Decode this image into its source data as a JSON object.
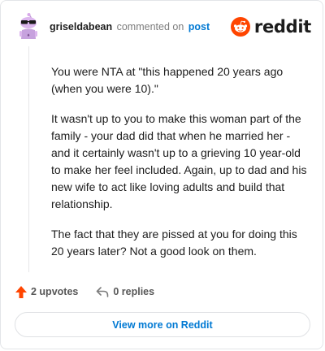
{
  "header": {
    "username": "griseldabean",
    "action_text": "commented on",
    "post_link": "post",
    "brand": "reddit"
  },
  "comment": {
    "paragraphs": [
      "You were NTA at \"this happened 20 years ago (when you were 10).\"",
      "It wasn't up to you to make this woman part of the family - your dad did that when he married her - and it certainly wasn't up to a grieving 10 year-old to make her feel included. Again, up to dad and his new wife to act like loving adults and build that relationship.",
      "The fact that they are pissed at you for doing this 20 years later? Not a good look on them."
    ]
  },
  "actions": {
    "upvotes": "2 upvotes",
    "replies": "0 replies"
  },
  "footer": {
    "view_more": "View more on Reddit"
  },
  "colors": {
    "upvote": "#ff4500",
    "link": "#0079d3",
    "brand": "#ff4500"
  }
}
